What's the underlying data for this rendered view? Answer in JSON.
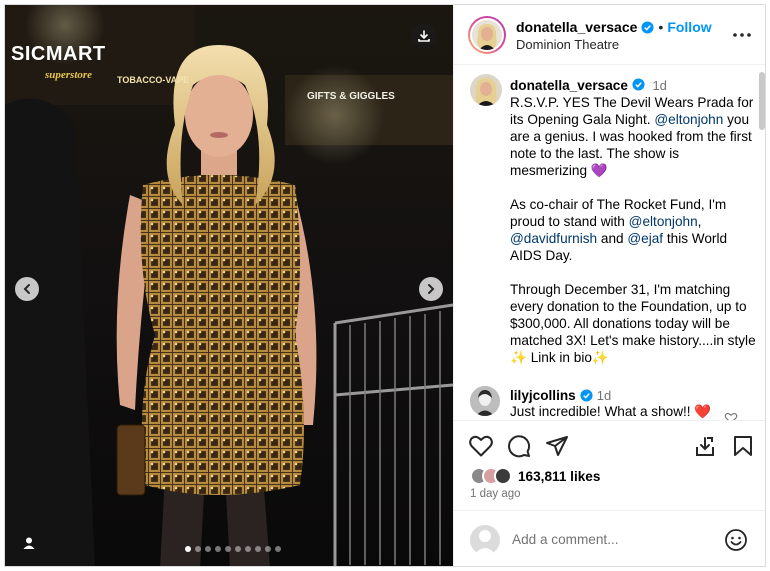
{
  "post": {
    "username": "donatella_versace",
    "location": "Dominion Theatre",
    "follow_label": "Follow",
    "separator": "•",
    "caption": {
      "time": "1d",
      "p1_a": "R.S.V.P. YES The Devil Wears Prada for its Opening Gala Night.",
      "p1_mention": "@eltonjohn",
      "p1_b": "you are a genius. I was hooked from the first note to the last. The show is mesmerizing 💜",
      "p2_a": "As co-chair of The Rocket Fund, I'm proud to stand with",
      "p2_m1": "@eltonjohn",
      "p2_m2": "@davidfurnish",
      "p2_and": "and",
      "p2_m3": "@ejaf",
      "p2_b": "this World AIDS Day.",
      "p3": "Through December 31, I'm matching every donation to the Foundation, up to $300,000. All donations today will be matched 3X! Let's make history....in style ✨ Link in bio✨"
    },
    "comment": {
      "username": "lilyjcollins",
      "time": "1d",
      "text": "Just incredible! What a show!! ❤️"
    },
    "likes": "163,811 likes",
    "posted": "1 day ago",
    "comment_placeholder": "Add a comment...",
    "carousel": {
      "count": 10,
      "active_index": 0
    }
  },
  "photo": {
    "sign_left": "SICMART",
    "sign_left_sub": "superstore",
    "sign_tobacco": "TOBACCO-VAPE",
    "sign_gifts": "GIFTS & GIGGLES"
  },
  "icons": {
    "verified": "verified-badge-icon",
    "more": "more-options-icon",
    "like": "heart-icon",
    "comment": "comment-icon",
    "share": "share-icon",
    "repost": "repost-icon",
    "save": "bookmark-icon",
    "emoji": "emoji-icon",
    "download": "download-icon",
    "prev": "chevron-left-icon",
    "next": "chevron-right-icon",
    "tag": "user-tag-icon"
  },
  "colors": {
    "link": "#0095f6",
    "mention": "#00376b",
    "meta": "#737373",
    "heart": "#ed4956"
  }
}
